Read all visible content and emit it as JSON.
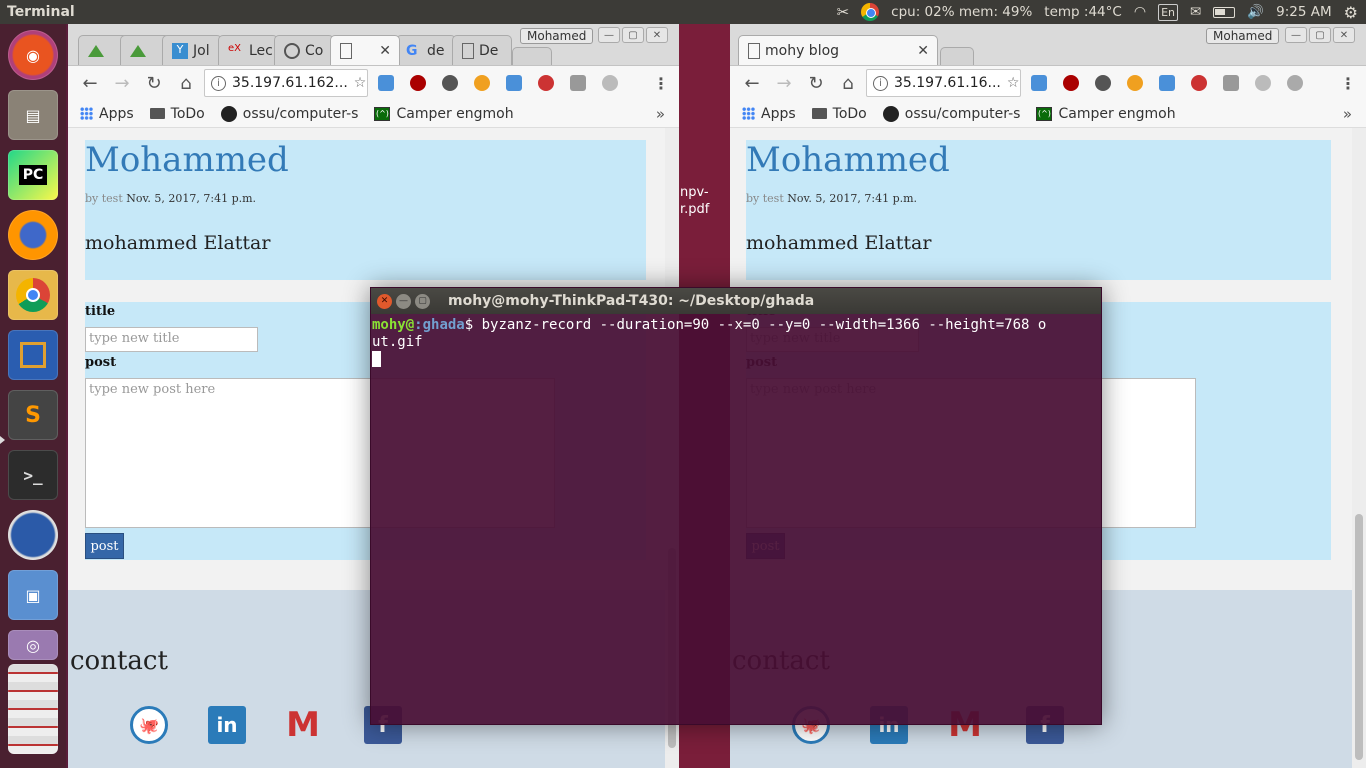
{
  "topbar": {
    "app_title": "Terminal",
    "sysmon": "cpu: 02% mem: 49%",
    "temp": "temp :44°C",
    "keyboard": "En",
    "time": "9:25 AM"
  },
  "left_browser": {
    "window_name": "Mohamed",
    "tabs": [
      {
        "label": ""
      },
      {
        "label": ""
      },
      {
        "label": "Jol"
      },
      {
        "label": "Lec"
      },
      {
        "label": "Co"
      },
      {
        "label": ""
      },
      {
        "label": "de"
      },
      {
        "label": "De"
      }
    ],
    "url": "35.197.61.162...",
    "bookmarks": [
      "Apps",
      "ToDo",
      "ossu/computer-s",
      "Camper engmoh"
    ],
    "more": "»"
  },
  "right_browser": {
    "window_name": "Mohamed",
    "tab_label": "mohy blog",
    "url": "35.197.61.16...",
    "bookmarks": [
      "Apps",
      "ToDo",
      "ossu/computer-s",
      "Camper engmoh"
    ],
    "more": "»"
  },
  "blog": {
    "post_title": "Mohammed",
    "meta_by": "by test",
    "meta_date": "Nov. 5, 2017, 7:41 p.m.",
    "post_body": "mohammed Elattar",
    "form": {
      "title_label": "title",
      "title_placeholder": "type new title",
      "post_label": "post",
      "post_placeholder": "type new post here",
      "submit_label": "post"
    },
    "contact_heading": "contact",
    "social": [
      "github-icon",
      "linkedin-icon",
      "gmail-icon",
      "facebook-icon"
    ]
  },
  "desktop": {
    "file_label_1": "npv-",
    "file_label_2": "r.pdf"
  },
  "terminal": {
    "title": "mohy@mohy-ThinkPad-T430: ~/Desktop/ghada",
    "prompt_user": "mohy@",
    "prompt_path": ":ghada",
    "prompt_symbol": "$",
    "command_line1": " byzanz-record --duration=90 --x=0 --y=0 --width=1366 --height=768 o",
    "command_line2": "ut.gif"
  },
  "colors": {
    "accent_link": "#337ab7",
    "post_bg": "#c6e8f8",
    "terminal_bg": "#480e34",
    "button": "#3567a8"
  }
}
